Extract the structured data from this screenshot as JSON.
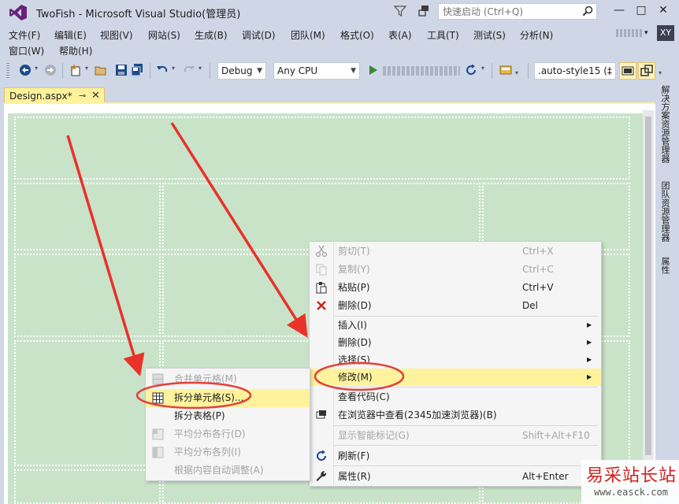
{
  "window": {
    "title": "TwoFish - Microsoft Visual Studio(管理员)",
    "quick_launch_placeholder": "快速启动 (Ctrl+Q)",
    "user_avatar": "XY",
    "controls": {
      "minimize": "—",
      "maximize": "□",
      "close": "✕"
    }
  },
  "menubar": {
    "items": [
      "文件(F)",
      "编辑(E)",
      "视图(V)",
      "网站(S)",
      "生成(B)",
      "调试(D)",
      "团队(M)",
      "格式(O)",
      "表(A)",
      "工具(T)",
      "测试(S)",
      "分析(N)",
      "窗口(W)",
      "帮助(H)"
    ]
  },
  "toolbar": {
    "configuration": "Debug",
    "platform": "Any CPU",
    "style_combo": ".auto-style15 (‡"
  },
  "document_tab": {
    "title": "Design.aspx*",
    "pin": "⊸",
    "close": "✕"
  },
  "side_tabs": [
    "解决方案资源管理器",
    "团队资源管理器",
    "属性"
  ],
  "context_menu": {
    "items": [
      {
        "label": "剪切(T)",
        "shortcut": "Ctrl+X",
        "icon": "scissors-icon",
        "disabled": true
      },
      {
        "label": "复制(Y)",
        "shortcut": "Ctrl+C",
        "icon": "copy-icon",
        "disabled": true
      },
      {
        "label": "粘贴(P)",
        "shortcut": "Ctrl+V",
        "icon": "paste-icon",
        "disabled": false
      },
      {
        "label": "删除(D)",
        "shortcut": "Del",
        "icon": "delete-x-icon",
        "disabled": false
      },
      {
        "label": "插入(I)",
        "submenu": true
      },
      {
        "label": "删除(D)",
        "submenu": true
      },
      {
        "label": "选择(S)",
        "submenu": true
      },
      {
        "label": "修改(M)",
        "submenu": true,
        "highlighted": true
      },
      {
        "label": "查看代码(C)"
      },
      {
        "label": "在浏览器中查看(2345加速浏览器)(B)",
        "icon": "browser-view-icon"
      },
      {
        "label": "显示智能标记(G)",
        "shortcut": "Shift+Alt+F10",
        "disabled": true
      },
      {
        "label": "刷新(F)",
        "icon": "refresh-icon"
      },
      {
        "label": "属性(R)",
        "shortcut": "Alt+Enter",
        "icon": "wrench-icon"
      }
    ]
  },
  "submenu": {
    "items": [
      {
        "label": "合并单元格(M)",
        "disabled": true
      },
      {
        "label": "拆分单元格(S)...",
        "highlighted": true
      },
      {
        "label": "拆分表格(P)"
      },
      {
        "label": "平均分布各行(D)",
        "disabled": true
      },
      {
        "label": "平均分布各列(I)",
        "disabled": true
      },
      {
        "label": "根据内容自动调整(A)",
        "disabled": true
      }
    ]
  },
  "watermark": {
    "text": "易采站长站",
    "url": "www.easck.com"
  },
  "colors": {
    "chrome": "#cfd6e5",
    "design_surface": "#c9e3c9",
    "highlight": "#fff29d",
    "annotation_red": "#e8322a",
    "vs_purple": "#68217a"
  }
}
